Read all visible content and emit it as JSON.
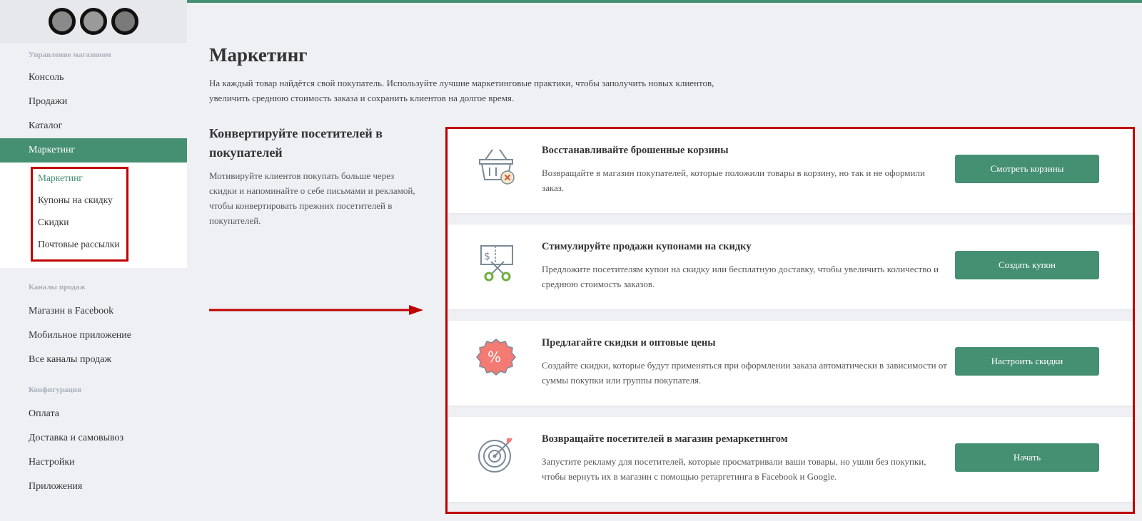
{
  "sidebar": {
    "store_section_label": "Управление магазином",
    "store_items": [
      {
        "label": "Консоль"
      },
      {
        "label": "Продажи"
      },
      {
        "label": "Каталог"
      },
      {
        "label": "Маркетинг"
      }
    ],
    "marketing_submenu": [
      {
        "label": "Маркетинг"
      },
      {
        "label": "Купоны на скидку"
      },
      {
        "label": "Скидки"
      },
      {
        "label": "Почтовые рассылки"
      }
    ],
    "channels_section_label": "Каналы продаж",
    "channels_items": [
      {
        "label": "Магазин в Facebook"
      },
      {
        "label": "Мобильное приложение"
      },
      {
        "label": "Все каналы продаж"
      }
    ],
    "config_section_label": "Конфигурация",
    "config_items": [
      {
        "label": "Оплата"
      },
      {
        "label": "Доставка и самовывоз"
      },
      {
        "label": "Настройки"
      },
      {
        "label": "Приложения"
      }
    ]
  },
  "main": {
    "title": "Маркетинг",
    "description": "На каждый товар найдётся свой покупатель. Используйте лучшие маркетинговые практики, чтобы заполучить новых клиентов, увеличить среднюю стоимость заказа и сохранить клиентов на долгое время.",
    "left_heading": "Конвертируйте посетителей в покупателей",
    "left_text": "Мотивируйте клиентов покупать больше через скидки и напоминайте о себе письмами и рекламой, чтобы конвертировать прежних посетителей в покупателей.",
    "cards": [
      {
        "icon": "basket-icon",
        "title": "Восстанавливайте брошенные корзины",
        "description": "Возвращайте в магазин покупателей, которые положили товары в корзину, но так и не оформили заказ.",
        "button": "Смотреть корзины"
      },
      {
        "icon": "coupon-scissors-icon",
        "title": "Стимулируйте продажи купонами на скидку",
        "description": "Предложите посетителям купон на скидку или бесплатную доставку, чтобы увеличить количество и среднюю стоимость заказов.",
        "button": "Создать купон"
      },
      {
        "icon": "percent-badge-icon",
        "title": "Предлагайте скидки и оптовые цены",
        "description": "Создайте скидки, которые будут применяться при оформлении заказа автоматически в зависимости от суммы покупки или группы покупателя.",
        "button": "Настроить скидки"
      },
      {
        "icon": "target-icon",
        "title": "Возвращайте посетителей в магазин ремаркетингом",
        "description": "Запустите рекламу для посетителей, которые просматривали ваши товары, но ушли без покупки, чтобы вернуть их в магазин с помощью ретаргетинга в Facebook и Google.",
        "button": "Начать"
      }
    ]
  },
  "colors": {
    "accent": "#458f72",
    "highlight_frame": "#c00000",
    "background": "#eef0f4"
  }
}
